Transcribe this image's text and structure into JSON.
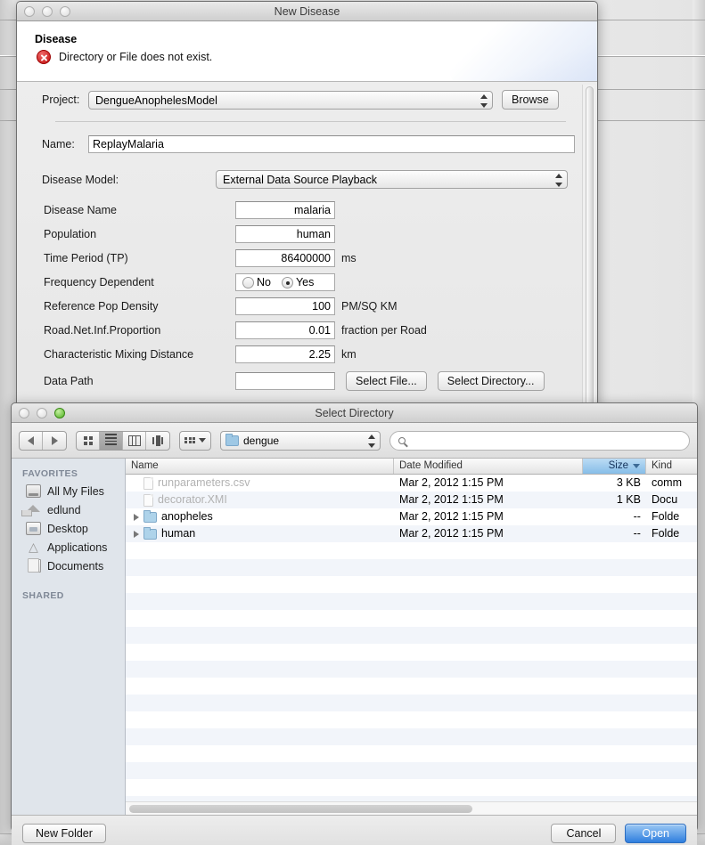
{
  "background_window": {
    "name": "background-window"
  },
  "new_disease": {
    "title": "New Disease",
    "header_title": "Disease",
    "error_message": "Directory or File does not exist.",
    "error_icon": "error-circle-icon",
    "project_label": "Project:",
    "project_value": "DengueAnophelesModel",
    "browse_label": "Browse",
    "name_label": "Name:",
    "name_value": "ReplayMalaria",
    "disease_model_label": "Disease Model:",
    "disease_model_value": "External Data Source Playback",
    "fields": [
      {
        "label": "Disease Name",
        "value": "malaria",
        "unit": ""
      },
      {
        "label": "Population",
        "value": "human",
        "unit": ""
      },
      {
        "label": "Time Period (TP)",
        "value": "86400000",
        "unit": "ms"
      }
    ],
    "frequency_dependent": {
      "label": "Frequency Dependent",
      "options": [
        {
          "label": "No",
          "selected": false
        },
        {
          "label": "Yes",
          "selected": true
        }
      ]
    },
    "fields2": [
      {
        "label": "Reference Pop Density",
        "value": "100",
        "unit": "PM/SQ KM"
      },
      {
        "label": "Road.Net.Inf.Proportion",
        "value": "0.01",
        "unit": "fraction per Road"
      },
      {
        "label": "Characteristic Mixing Distance",
        "value": "2.25",
        "unit": "km"
      }
    ],
    "data_path": {
      "label": "Data Path",
      "value": "",
      "select_file_label": "Select File...",
      "select_directory_label": "Select Directory..."
    }
  },
  "select_directory": {
    "title": "Select Directory",
    "toolbar": {
      "back_icon": "back-arrow-icon",
      "forward_icon": "forward-arrow-icon",
      "view_icon_grid": "icon-view-icon",
      "view_list": "list-view-icon",
      "view_column": "column-view-icon",
      "view_coverflow": "coverflow-view-icon",
      "action_icon": "action-gear-icon",
      "path_value": "dengue",
      "search_placeholder": ""
    },
    "sidebar": {
      "sections": [
        {
          "header": "FAVORITES",
          "items": [
            {
              "label": "All My Files",
              "icon": "all-my-files-icon"
            },
            {
              "label": "edlund",
              "icon": "home-icon"
            },
            {
              "label": "Desktop",
              "icon": "desktop-icon"
            },
            {
              "label": "Applications",
              "icon": "applications-icon"
            },
            {
              "label": "Documents",
              "icon": "documents-icon"
            }
          ]
        },
        {
          "header": "SHARED",
          "items": []
        }
      ]
    },
    "columns": [
      {
        "label": "Name",
        "sorted": false
      },
      {
        "label": "Date Modified",
        "sorted": false
      },
      {
        "label": "Size",
        "sorted": true
      },
      {
        "label": "Kind",
        "sorted": false
      }
    ],
    "rows": [
      {
        "name": "runparameters.csv",
        "date": "Mar 2, 2012 1:15 PM",
        "size": "3 KB",
        "kind": "comm",
        "type": "file",
        "disabled": true
      },
      {
        "name": "decorator.XMI",
        "date": "Mar 2, 2012 1:15 PM",
        "size": "1 KB",
        "kind": "Docu",
        "type": "file",
        "disabled": true
      },
      {
        "name": "anopheles",
        "date": "Mar 2, 2012 1:15 PM",
        "size": "--",
        "kind": "Folde",
        "type": "folder",
        "disabled": false
      },
      {
        "name": "human",
        "date": "Mar 2, 2012 1:15 PM",
        "size": "--",
        "kind": "Folde",
        "type": "folder",
        "disabled": false
      }
    ],
    "footer": {
      "new_folder_label": "New Folder",
      "cancel_label": "Cancel",
      "open_label": "Open"
    }
  },
  "colors": {
    "accent_blue": "#2f7ede",
    "sorted_column": "#86bde8",
    "error_red": "#c00c0c",
    "folder_blue": "#aed3ea"
  }
}
